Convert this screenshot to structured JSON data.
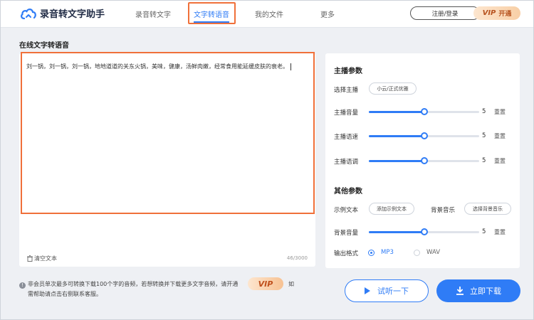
{
  "colors": {
    "accent": "#2f7cf6",
    "highlight": "#f0703a",
    "vip": "#c0501c"
  },
  "header": {
    "app_name": "录音转文字助手",
    "nav": [
      {
        "label": "录音转文字",
        "active": false
      },
      {
        "label": "文字转语音",
        "active": true
      },
      {
        "label": "我的文件",
        "active": false
      },
      {
        "label": "更多",
        "active": false
      }
    ],
    "login_label": "注册/登录",
    "vip_logo": "VIP",
    "vip_label": "开通"
  },
  "main": {
    "title": "在线文字转语音",
    "editor_text": "刘一锅，刘一锅，刘一锅，地地道道的关东火锅，美味，健康，汤鲜肉嫩，经常食用能延缓皮肤的衰老。",
    "clear_label": "清空文本",
    "char_count": "46/3000"
  },
  "settings": {
    "anchor_title": "主播参数",
    "select_anchor_label": "选择主播",
    "anchor_chip": "小云/正式优雅",
    "volume_label": "主播音量",
    "volume_value": "5",
    "speed_label": "主播语速",
    "speed_value": "5",
    "pitch_label": "主播语调",
    "pitch_value": "5",
    "reset_label": "重置",
    "other_title": "其他参数",
    "example_label": "示例文本",
    "example_chip": "添加示例文本",
    "bgm_label": "背景音乐",
    "bgm_chip": "选择背景音乐",
    "bgm_volume_label": "背景音量",
    "bgm_volume_value": "5",
    "format_label": "输出格式",
    "format_options": [
      "MP3",
      "WAV"
    ],
    "format_selected": "MP3",
    "slider_levels": {
      "volume": 0.5,
      "speed": 0.5,
      "pitch": 0.5,
      "bgm_volume": 0.5
    }
  },
  "notice": {
    "line1": "非会员单次最多可转换下载100个字的音频，若想转换并下载更多文字音频，请开通",
    "vip": "VIP",
    "suffix": "如",
    "line2": "需帮助请点击右侧联系客服。"
  },
  "actions": {
    "try_label": "试听一下",
    "download_label": "立即下载"
  }
}
